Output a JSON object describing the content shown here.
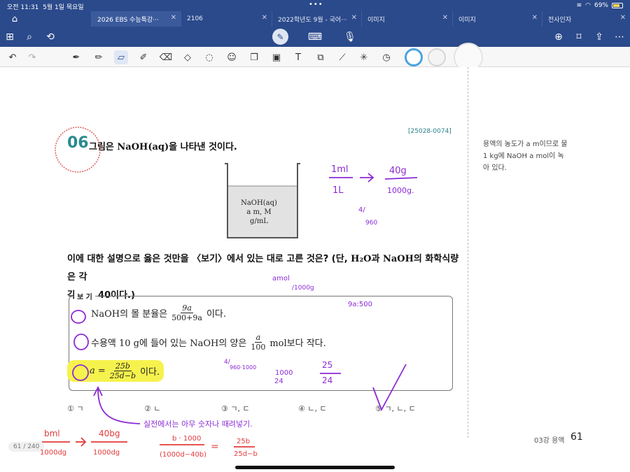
{
  "status": {
    "time": "오전 11:31",
    "date": "5월 1일 목요일",
    "battery": "69%"
  },
  "tabs": [
    {
      "label": "2026 EBS 수능특강···",
      "active": true
    },
    {
      "label": "2106",
      "active": false
    },
    {
      "label": "2022학년도 9월 - 국어···",
      "active": false
    },
    {
      "label": "이미지",
      "active": false
    },
    {
      "label": "이미지",
      "active": false
    },
    {
      "label": "전사인자",
      "active": false
    }
  ],
  "toolbar1": {
    "left_icons": [
      "grid-icon",
      "search-icon",
      "share-back-icon"
    ],
    "center_icons": [
      "pen-mode-icon",
      "keyboard-icon",
      "microphone-icon"
    ],
    "right_icons": [
      "add-page-icon",
      "bookmark-icon",
      "export-icon",
      "more-icon"
    ]
  },
  "toolbar2": {
    "tools": [
      "undo-icon",
      "redo-icon",
      "pen-icon",
      "pencil-icon",
      "highlighter-icon",
      "marker-icon",
      "eraser-icon",
      "shape-icon",
      "lasso-icon",
      "sticker-icon",
      "copy-icon",
      "image-icon",
      "text-icon",
      "scan-icon",
      "ruler-icon",
      "laser-pointer-icon",
      "clock-icon"
    ],
    "colors": [
      "#4aa3df",
      "#e0e0e0",
      "#d0d0d0"
    ]
  },
  "question": {
    "code": "[25028-0074]",
    "number": "06",
    "title_pre": "그림은 ",
    "title_formula": "NaOH(aq)",
    "title_post": "을 나타낸 것이다.",
    "beaker_line1": "NaOH(aq)",
    "beaker_line2": "a m,  M",
    "beaker_line3": " g/mL",
    "text_line1_a": "이에 대한 설명으로 옳은 것만을 〈보기〉에서 있는 대로 고른 것은? (단, ",
    "text_h2o": "H₂O",
    "text_mid": "과 ",
    "text_naoh": "NaOH",
    "text_line1_b": "의 화학식량은 각",
    "text_line2": "각 18, 40이다.)",
    "box_label": "보 기",
    "item1_pre": "NaOH의 몰 분율은",
    "item1_num": "9a",
    "item1_den": "500+9a",
    "item1_post": "이다.",
    "item2_pre": "수용액 10 g에 들어 있는 NaOH의 양은",
    "item2_num": "a",
    "item2_den": "100",
    "item2_post": "mol보다 작다.",
    "item3_pre": "a =",
    "item3_num": "25b",
    "item3_den": "25d−b",
    "item3_post": "이다.",
    "choices": [
      "① ㄱ",
      "② ㄴ",
      "③ ㄱ, ㄷ",
      "④ ㄴ, ㄷ",
      "⑤ ㄱ, ㄴ, ㄷ"
    ]
  },
  "sidebar": {
    "line1": "용액의 농도가 a m이므로 물",
    "line2": "1 kg에 NaOH a mol이 녹",
    "line3": "아 있다."
  },
  "footer": {
    "chapter": "03강 용액",
    "page_number": "61",
    "page_indicator": "61 / 240"
  },
  "ink_notes": {
    "note1_num": "1ml",
    "note1_den": "1L",
    "note2_num": "40g",
    "note2_den": "1000g.",
    "note3": "4/",
    "note3b": "960",
    "note4": "amol",
    "note4b": "/1000g",
    "note5": "9a:500",
    "note6": "4/",
    "note6b": "960·1000",
    "note7": "1000",
    "note7b": "24",
    "note8_num": "25",
    "note8_den": "24",
    "note9": "실전에서는 아무 숫자나 때려넣기.",
    "note10_num": "bml",
    "note10_den": "1000dg",
    "note11_num": "40bg",
    "note11_den": "1000dg",
    "note12_num": "b · 1000",
    "note12_den": "(1000d−40b)",
    "note13": "=",
    "note14_num": "25b",
    "note14_den": "25d−b"
  }
}
